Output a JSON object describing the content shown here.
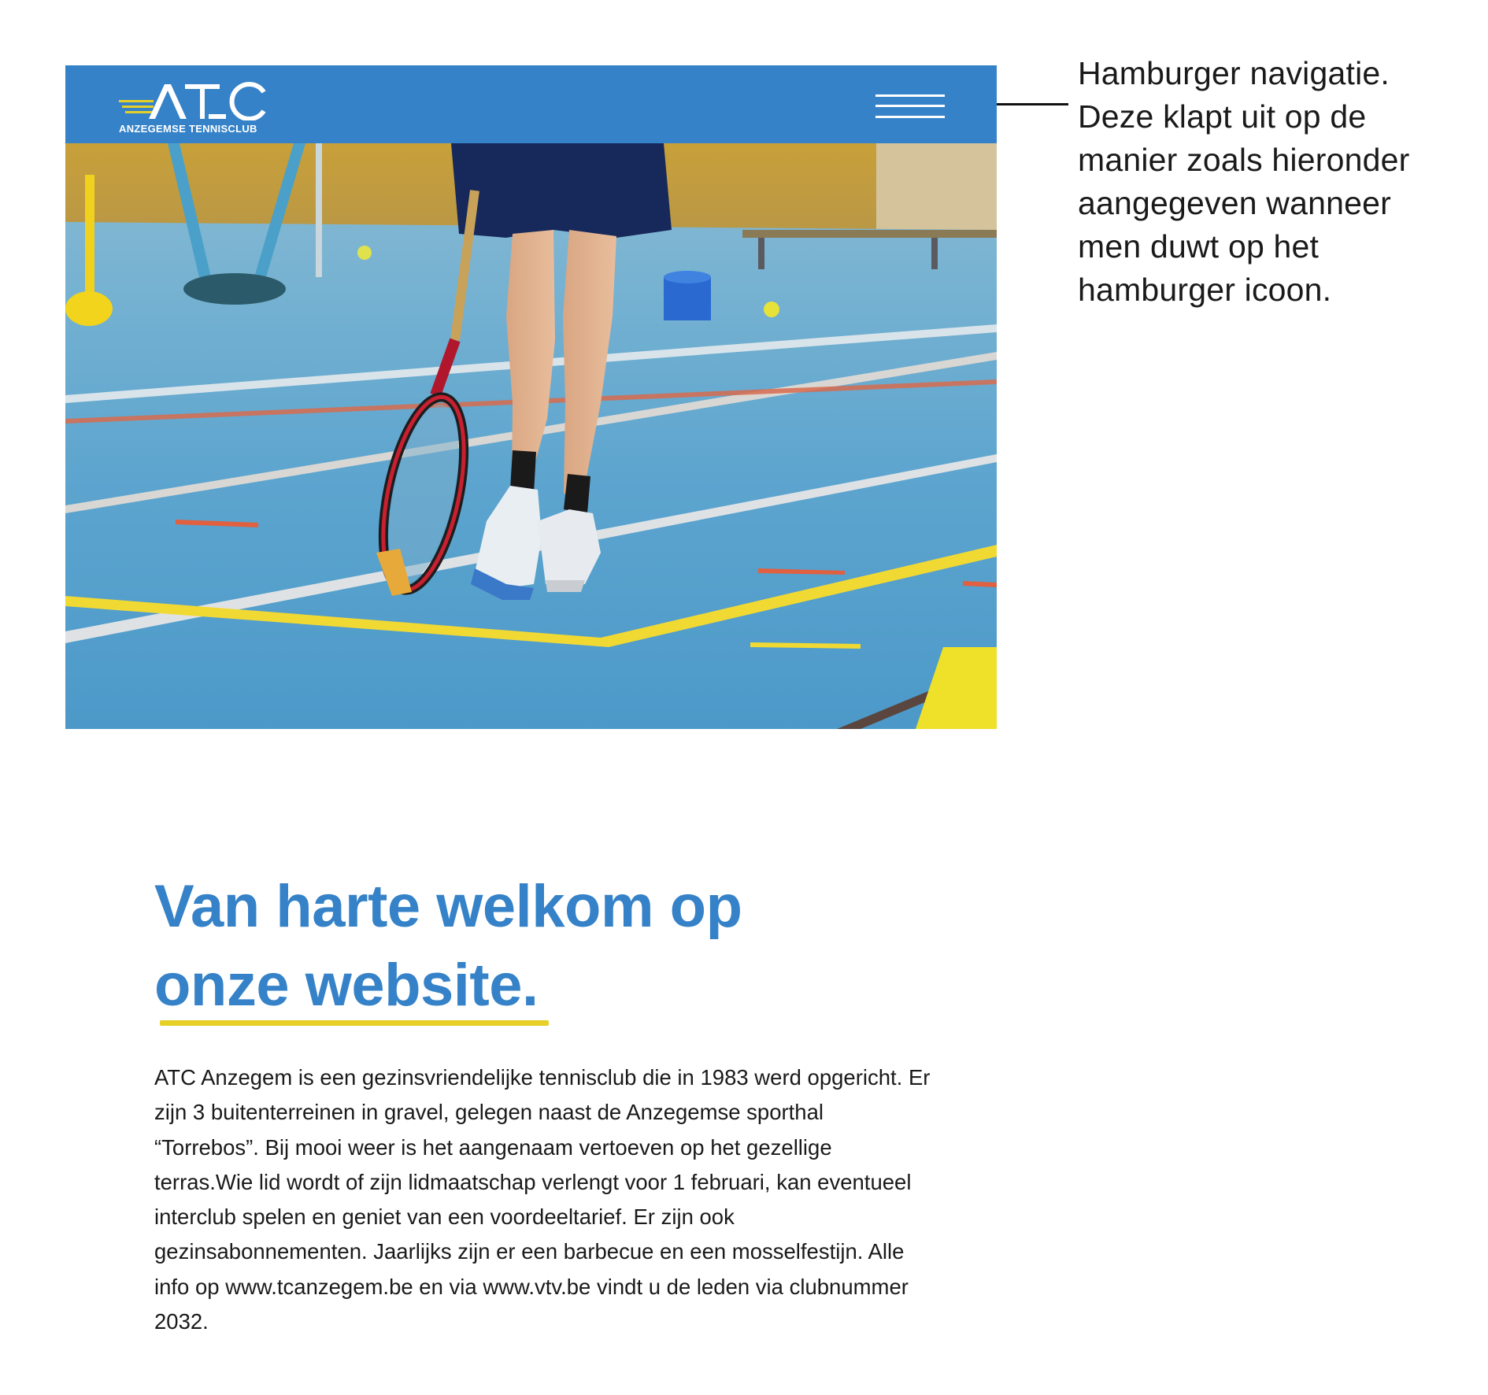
{
  "header": {
    "logo_text": "ATC",
    "logo_subtitle": "ANZEGEMSE TENNISCLUB",
    "menu_icon": "hamburger-icon"
  },
  "hero": {
    "image_name": "tennis-player-photo"
  },
  "annotation": {
    "text": "Hamburger navigatie. Deze klapt uit op de manier zoals hieronder aangegeven wanneer men duwt op het hamburger icoon."
  },
  "welcome": {
    "title_line1": "Van harte welkom op",
    "title_line2": "onze website.",
    "body": "ATC Anzegem is een gezinsvriendelijke tennisclub die in 1983 werd opgericht. Er zijn 3 buitenterreinen in gravel, gelegen naast de Anzegemse sporthal “Torrebos”. Bij mooi weer is het aangenaam vertoeven op het gezellige terras.Wie lid wordt of zijn lidmaatschap verlengt voor 1 februari, kan eventueel interclub spelen en geniet van een voordeeltarief. Er zijn ook gezinsabonnementen. Jaarlijks zijn er een barbecue en een mosselfestijn. Alle info op www.tcanzegem.be en via www.vtv.be vindt u de leden via clubnummer 2032."
  },
  "colors": {
    "brand_blue": "#3582c8",
    "accent_yellow": "#e6cf27",
    "court_blue": "#5aa3cc"
  }
}
